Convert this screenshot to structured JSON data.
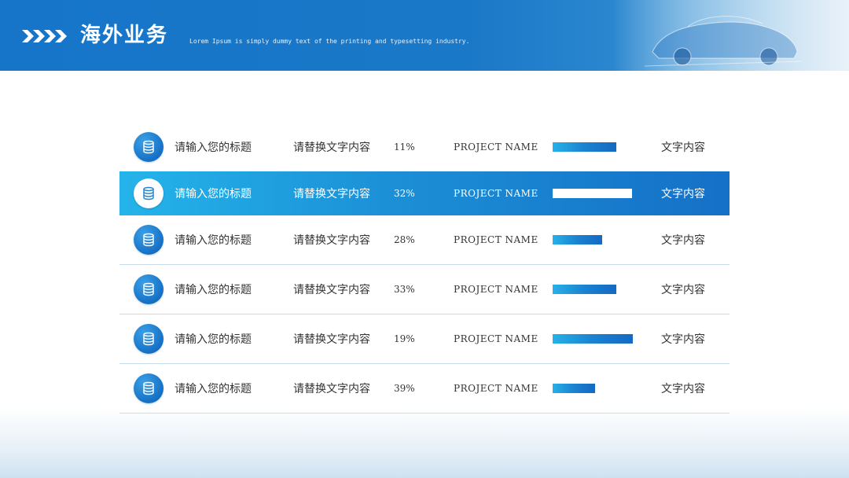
{
  "header": {
    "title": "海外业务",
    "subtitle": "Lorem Ipsum is simply dummy text of the printing and typesetting industry.",
    "chevrons_icon": "double-chevron-right-icon",
    "banner_image": "car-wireframe-illustration"
  },
  "colors": {
    "header_blue": "#1675c9",
    "accent_cyan": "#24b4ea",
    "row_divider": "#c9dbe7",
    "text_dark": "#333333"
  },
  "table": {
    "active_row_index": 1,
    "row_icon": "database-icon",
    "rows": [
      {
        "title": "请输入您的标题",
        "replace_text": "请替换文字内容",
        "percent": "11%",
        "project": "PROJECT NAME",
        "bar_level": 0.74,
        "text": "文字内容"
      },
      {
        "title": "请输入您的标题",
        "replace_text": "请替换文字内容",
        "percent": "32%",
        "project": "PROJECT NAME",
        "bar_level": 0.92,
        "text": "文字内容"
      },
      {
        "title": "请输入您的标题",
        "replace_text": "请替换文字内容",
        "percent": "28%",
        "project": "PROJECT NAME",
        "bar_level": 0.57,
        "text": "文字内容"
      },
      {
        "title": "请输入您的标题",
        "replace_text": "请替换文字内容",
        "percent": "33%",
        "project": "PROJECT NAME",
        "bar_level": 0.74,
        "text": "文字内容"
      },
      {
        "title": "请输入您的标题",
        "replace_text": "请替换文字内容",
        "percent": "19%",
        "project": "PROJECT NAME",
        "bar_level": 0.93,
        "text": "文字内容"
      },
      {
        "title": "请输入您的标题",
        "replace_text": "请替换文字内容",
        "percent": "39%",
        "project": "PROJECT NAME",
        "bar_level": 0.49,
        "text": "文字内容"
      }
    ]
  }
}
